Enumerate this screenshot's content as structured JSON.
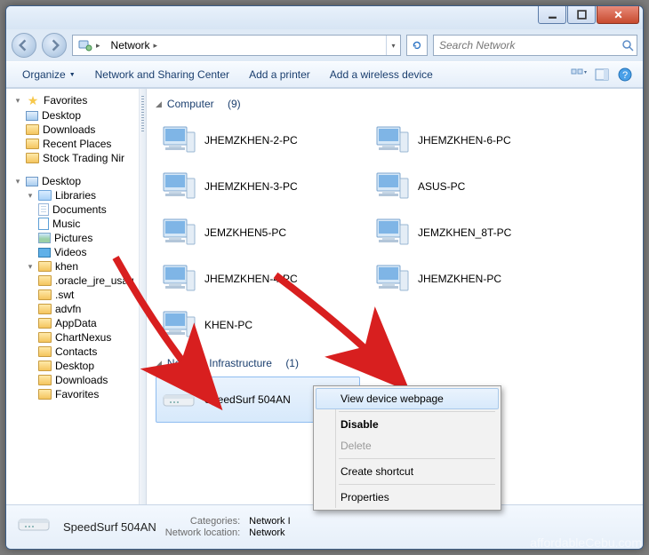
{
  "window": {},
  "address": {
    "root": "Network"
  },
  "search": {
    "placeholder": "Search Network"
  },
  "toolbar": {
    "organize": "Organize",
    "nsc": "Network and Sharing Center",
    "add_printer": "Add a printer",
    "add_wireless": "Add a wireless device"
  },
  "sidebar": {
    "favorites": "Favorites",
    "favs": {
      "desktop": "Desktop",
      "downloads": "Downloads",
      "recent": "Recent Places",
      "stock": "Stock Trading Nir"
    },
    "desktop_root": "Desktop",
    "libraries": "Libraries",
    "libs": {
      "documents": "Documents",
      "music": "Music",
      "pictures": "Pictures",
      "videos": "Videos"
    },
    "user": "khen",
    "userf": {
      "oracle": ".oracle_jre_usag",
      "swt": ".swt",
      "advfn": "advfn",
      "appdata": "AppData",
      "chartnexus": "ChartNexus",
      "contacts": "Contacts",
      "desktop": "Desktop",
      "downloads": "Downloads",
      "favorites": "Favorites"
    }
  },
  "groups": {
    "computer": {
      "label": "Computer",
      "count": "(9)"
    },
    "infra": {
      "label": "Network Infrastructure",
      "count": "(1)"
    }
  },
  "computers": {
    "left": {
      "0": "JHEMZKHEN-2-PC",
      "1": "JHEMZKHEN-3-PC",
      "2": "JEMZKHEN5-PC",
      "3": "JHEMZKHEN-4-PC",
      "4": "KHEN-PC"
    },
    "right": {
      "0": "JHEMZKHEN-6-PC",
      "1": "ASUS-PC",
      "2": "JEMZKHEN_8T-PC",
      "3": "JHEMZKHEN-PC"
    }
  },
  "infra": {
    "router": "SpeedSurf 504AN"
  },
  "contextmenu": {
    "view_webpage": "View device webpage",
    "disable": "Disable",
    "delete": "Delete",
    "shortcut": "Create shortcut",
    "properties": "Properties"
  },
  "details": {
    "name": "SpeedSurf 504AN",
    "cat_label": "Categories:",
    "cat_value": "Network I",
    "loc_label": "Network location:",
    "loc_value": "Network"
  },
  "watermark": "affordableCebu.com"
}
